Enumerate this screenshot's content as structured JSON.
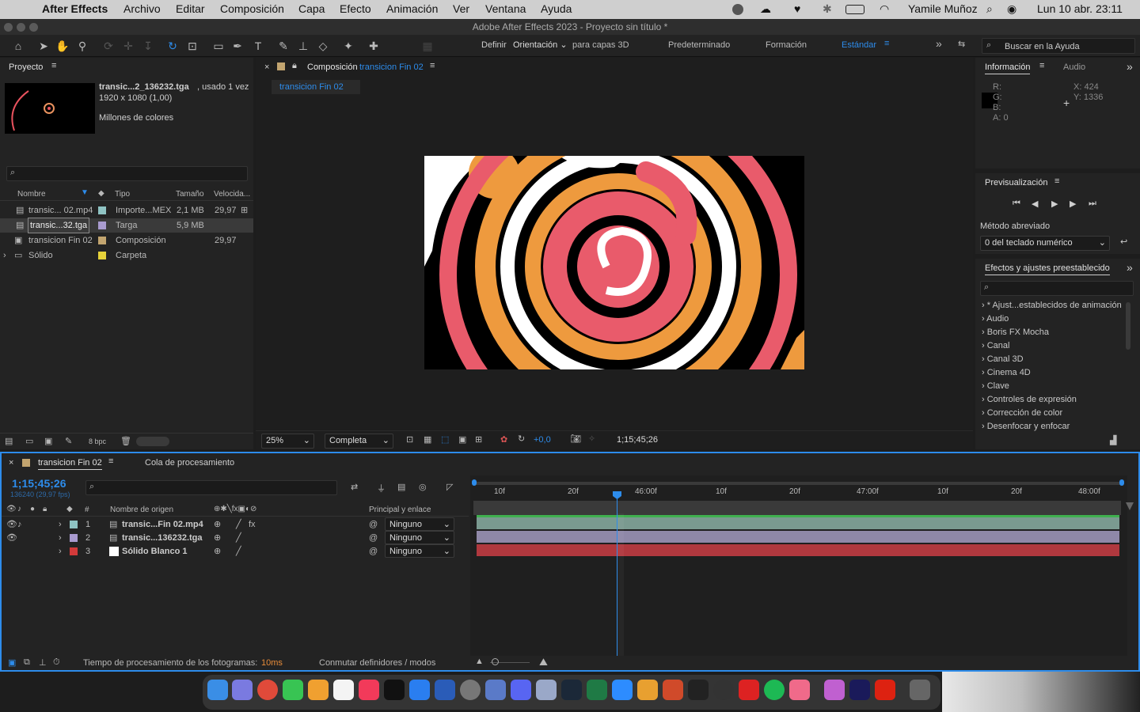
{
  "menubar": {
    "app": "After Effects",
    "items": [
      "Archivo",
      "Editar",
      "Composición",
      "Capa",
      "Efecto",
      "Animación",
      "Ver",
      "Ventana",
      "Ayuda"
    ],
    "user": "Yamile Muñoz",
    "datetime": "Lun 10 abr.  23:11"
  },
  "window_title": "Adobe After Effects 2023 - Proyecto sin título *",
  "toolbar": {
    "definir": "Definir",
    "orientacion": "Orientación",
    "para_capas": "para capas 3D",
    "workspaces": [
      "Predeterminado",
      "Formación",
      "Estándar"
    ],
    "search_placeholder": "Buscar en la Ayuda"
  },
  "project": {
    "tab": "Proyecto",
    "selected_name": "transic...2_136232.tga",
    "used": ", usado 1 vez",
    "dims": "1920 x 1080 (1,00)",
    "colors": "Millones de colores",
    "columns": [
      "Nombre",
      "Tipo",
      "Tamaño",
      "Velocida..."
    ],
    "items": [
      {
        "name": "transic... 02.mp4",
        "type": "Importe...MEX",
        "size": "2,1 MB",
        "fps": "29,97",
        "color": "#8fc3c3"
      },
      {
        "name": "transic...32.tga",
        "type": "Targa",
        "size": "5,9 MB",
        "fps": "",
        "color": "#a99bcf"
      },
      {
        "name": "transicion Fin 02",
        "type": "Composición",
        "size": "",
        "fps": "29,97",
        "color": "#c2a46f"
      },
      {
        "name": "Sólido",
        "type": "Carpeta",
        "size": "",
        "fps": "",
        "color": "#e6d23a"
      }
    ],
    "bpc": "8 bpc"
  },
  "composition": {
    "tab_prefix": "Composición",
    "tab_name": "transicion Fin 02",
    "subtab": "transicion Fin 02",
    "zoom": "25%",
    "quality": "Completa",
    "exposure": "+0,0",
    "timecode": "1;15;45;26"
  },
  "info": {
    "tab": "Información",
    "tab2": "Audio",
    "r": "R:",
    "g": "G:",
    "b": "B:",
    "a": "A:  0",
    "x": "X:  424",
    "y": "Y:  1336"
  },
  "preview": {
    "tab": "Previsualización",
    "method_label": "Método abreviado",
    "method_value": "0 del teclado numérico"
  },
  "effects": {
    "tab": "Efectos y ajustes preestablecido",
    "items": [
      "* Ajust...establecidos de animación",
      "Audio",
      "Boris FX Mocha",
      "Canal",
      "Canal 3D",
      "Cinema 4D",
      "Clave",
      "Controles de expresión",
      "Corrección de color",
      "Desenfocar y enfocar"
    ]
  },
  "timeline": {
    "tab": "transicion Fin 02",
    "tab2": "Cola de procesamiento",
    "timecode": "1;15;45;26",
    "frames": "136240 (29,97 fps)",
    "col_name": "Nombre de origen",
    "col_parent": "Principal y enlace",
    "layers": [
      {
        "num": "1",
        "name": "transic...Fin 02.mp4",
        "parent": "Ninguno",
        "color": "#8fc3c3"
      },
      {
        "num": "2",
        "name": "transic...136232.tga",
        "parent": "Ninguno",
        "color": "#a99bcf"
      },
      {
        "num": "3",
        "name": "Sólido Blanco 1",
        "parent": "Ninguno",
        "color": "#d23a3a"
      }
    ],
    "ruler": [
      "10f",
      "20f",
      "46:00f",
      "10f",
      "20f",
      "47:00f",
      "10f",
      "20f",
      "48:00f"
    ],
    "render_time_label": "Tiempo de procesamiento de los fotogramas:",
    "render_time_value": "10ms",
    "toggle": "Conmutar definidores / modos"
  },
  "colors": {
    "accent": "#2d8ceb",
    "green_bar": "#7a9a90",
    "purple_bar": "#8f88a8",
    "red_bar": "#b0383e"
  }
}
